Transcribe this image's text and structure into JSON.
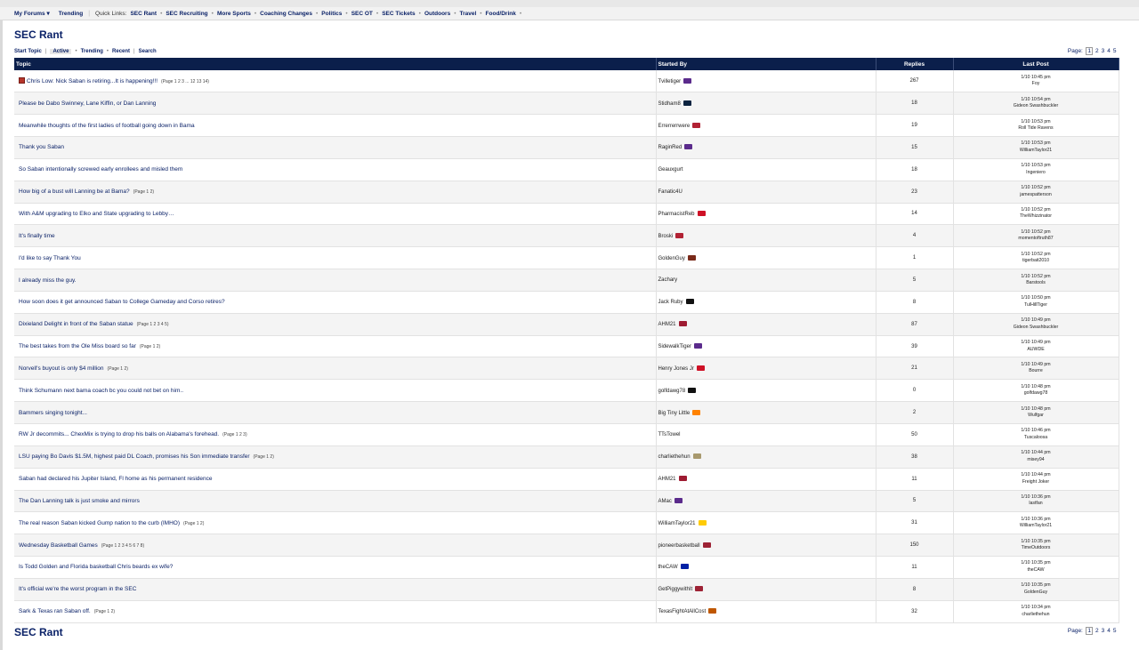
{
  "nav": {
    "my_forums": "My Forums ▾",
    "trending": "Trending",
    "quick_links_label": "Quick Links:",
    "quick_links": [
      "SEC Rant",
      "SEC Recruiting",
      "More Sports",
      "Coaching Changes",
      "Politics",
      "SEC OT",
      "SEC Tickets",
      "Outdoors",
      "Travel",
      "Food/Drink"
    ]
  },
  "page_title": "SEC Rant",
  "subnav": {
    "start_topic": "Start Topic",
    "active": "Active",
    "trending": "Trending",
    "recent": "Recent",
    "search": "Search"
  },
  "pager": {
    "label": "Page:",
    "pages": [
      "1",
      "2",
      "3",
      "4",
      "5"
    ],
    "current": "1"
  },
  "columns": {
    "topic": "Topic",
    "started_by": "Started By",
    "replies": "Replies",
    "last_post": "Last Post"
  },
  "topics": [
    {
      "title": "Chris Low: Nick Saban is retiring...It is happening!!!",
      "pages": "(Page 1 2 3 ... 12 13 14)",
      "author": "Tvilletiger",
      "logo": "lsu-logo",
      "replies": "267",
      "last_time": "1/10 10:45 pm",
      "last_user": "Foy",
      "hot": true
    },
    {
      "title": "Please be Dabo Swinney, Lane Kiffin, or Dan Lanning",
      "pages": "",
      "author": "Stidham8",
      "logo": "auburn-logo",
      "replies": "18",
      "last_time": "1/10 10:54 pm",
      "last_user": "Gideon Swashbuckler"
    },
    {
      "title": "Meanwhile thoughts of the first ladies of football going down in Bama",
      "pages": "",
      "author": "Errerrerrwere",
      "logo": "usa-flag",
      "replies": "19",
      "last_time": "1/10 10:53 pm",
      "last_user": "Roll Tide Ravens"
    },
    {
      "title": "Thank you Saban",
      "pages": "",
      "author": "RaginRed",
      "logo": "lsu-logo",
      "replies": "15",
      "last_time": "1/10 10:53 pm",
      "last_user": "WilliamTaylor21"
    },
    {
      "title": "So Saban intentionally screwed early enrollees and misled them",
      "pages": "",
      "author": "Geauxgurt",
      "logo": "",
      "replies": "18",
      "last_time": "1/10 10:53 pm",
      "last_user": "Ingeniero"
    },
    {
      "title": "How big of a bust will Lanning be at Bama?",
      "pages": "(Page 1 2)",
      "author": "Fanatic4U",
      "logo": "",
      "replies": "23",
      "last_time": "1/10 10:52 pm",
      "last_user": "jamespatterson"
    },
    {
      "title": "With A&M upgrading to Elko and State upgrading to Lebby…",
      "pages": "",
      "author": "PharmacistReb",
      "logo": "ole-miss-logo",
      "replies": "14",
      "last_time": "1/10 10:52 pm",
      "last_user": "TheWhizzinator"
    },
    {
      "title": "It's finally time",
      "pages": "",
      "author": "Broski",
      "logo": "usa-flag",
      "replies": "4",
      "last_time": "1/10 10:52 pm",
      "last_user": "momentoftruth87"
    },
    {
      "title": "I'd like to say Thank You",
      "pages": "",
      "author": "GoldenGuy",
      "logo": "trophy-logo",
      "replies": "1",
      "last_time": "1/10 10:52 pm",
      "last_user": "tigerbait2010"
    },
    {
      "title": "I already miss the guy.",
      "pages": "",
      "author": "Zachary",
      "logo": "",
      "replies": "5",
      "last_time": "1/10 10:52 pm",
      "last_user": "Barstools"
    },
    {
      "title": "How soon does it get announced Saban to College Gameday and Corso retires?",
      "pages": "",
      "author": "Jack Ruby",
      "logo": "black-flag",
      "replies": "8",
      "last_time": "1/10 10:50 pm",
      "last_user": "TulHillTiger"
    },
    {
      "title": "Dixieland Delight in front of the Saban statue",
      "pages": "(Page 1 2 3 4 5)",
      "author": "AHM21",
      "logo": "alabama-logo",
      "replies": "87",
      "last_time": "1/10 10:49 pm",
      "last_user": "Gideon Swashbuckler"
    },
    {
      "title": "The best takes from the Ole Miss board so far",
      "pages": "(Page 1 2)",
      "author": "SidewalkTiger",
      "logo": "lsu-logo",
      "replies": "39",
      "last_time": "1/10 10:49 pm",
      "last_user": "AUWDE"
    },
    {
      "title": "Norvell's buyout is only $4 million",
      "pages": "(Page 1 2)",
      "author": "Henry Jones Jr",
      "logo": "ole-miss-logo",
      "replies": "21",
      "last_time": "1/10 10:49 pm",
      "last_user": "Bourre"
    },
    {
      "title": "Think Schumann next bama coach bc you could not bet on him..",
      "pages": "",
      "author": "golfdawg78",
      "logo": "georgia-logo",
      "replies": "0",
      "last_time": "1/10 10:48 pm",
      "last_user": "golfdawg78"
    },
    {
      "title": "Bammers singing tonight...",
      "pages": "",
      "author": "Big Tiny Little",
      "logo": "tennessee-logo",
      "replies": "2",
      "last_time": "1/10 10:48 pm",
      "last_user": "Wulfgar"
    },
    {
      "title": "RW Jr decommits... ChexMix is trying to drop his balls on Alabama's forehead.",
      "pages": "(Page 1 2 3)",
      "author": "TTsTowel",
      "logo": "",
      "replies": "50",
      "last_time": "1/10 10:46 pm",
      "last_user": "Tuscaloosa"
    },
    {
      "title": "LSU paying Bo Davis $1.5M, highest paid DL Coach, promises his Son immediate transfer",
      "pages": "(Page 1 2)",
      "author": "charliethehun",
      "logo": "vanderbilt-logo",
      "replies": "38",
      "last_time": "1/10 10:44 pm",
      "last_user": "misey94"
    },
    {
      "title": "Saban had declared his Jupiter Island, Fl home as his permanent residence",
      "pages": "",
      "author": "AHM21",
      "logo": "alabama-logo",
      "replies": "11",
      "last_time": "1/10 10:44 pm",
      "last_user": "Freight Joker"
    },
    {
      "title": "The Dan Lanning talk is just smoke and mirrors",
      "pages": "",
      "author": "AMac",
      "logo": "lsu-logo",
      "replies": "5",
      "last_time": "1/10 10:36 pm",
      "last_user": "lastfan"
    },
    {
      "title": "The real reason Saban kicked Gump nation to the curb (IMHO)",
      "pages": "(Page 1 2)",
      "author": "WilliamTaylor21",
      "logo": "michigan-logo",
      "replies": "31",
      "last_time": "1/10 10:36 pm",
      "last_user": "WilliamTaylor21"
    },
    {
      "title": "Wednesday Basketball Games",
      "pages": "(Page 1 2 3 4 5 6 7 8)",
      "author": "pioneerbasketball",
      "logo": "arkansas-logo",
      "replies": "150",
      "last_time": "1/10 10:35 pm",
      "last_user": "TimeOutdoors"
    },
    {
      "title": "Is Todd Golden and Florida basketball Chris beards ex wife?",
      "pages": "",
      "author": "theCAW",
      "logo": "florida-logo",
      "replies": "11",
      "last_time": "1/10 10:35 pm",
      "last_user": "theCAW"
    },
    {
      "title": "It's official we're the worst program in the SEC",
      "pages": "",
      "author": "GetPiggywithIt",
      "logo": "arkansas-logo",
      "replies": "8",
      "last_time": "1/10 10:35 pm",
      "last_user": "GoldenGuy"
    },
    {
      "title": "Sark & Texas ran Saban off.",
      "pages": "(Page 1 2)",
      "author": "TexasFightAtAllCost",
      "logo": "texas-logo",
      "replies": "32",
      "last_time": "1/10 10:34 pm",
      "last_user": "charliethehun"
    }
  ],
  "logo_colors": {
    "lsu-logo": "#5b2b8c",
    "auburn-logo": "#0c2340",
    "usa-flag": "#b22234",
    "ole-miss-logo": "#ce1126",
    "trophy-logo": "#7a2a1a",
    "black-flag": "#111111",
    "alabama-logo": "#9e1b32",
    "georgia-logo": "#111111",
    "tennessee-logo": "#ff8200",
    "vanderbilt-logo": "#a8996e",
    "michigan-logo": "#ffcb05",
    "arkansas-logo": "#9d2235",
    "florida-logo": "#0021a5",
    "texas-logo": "#bf5700"
  },
  "footer_title": "SEC Rant"
}
